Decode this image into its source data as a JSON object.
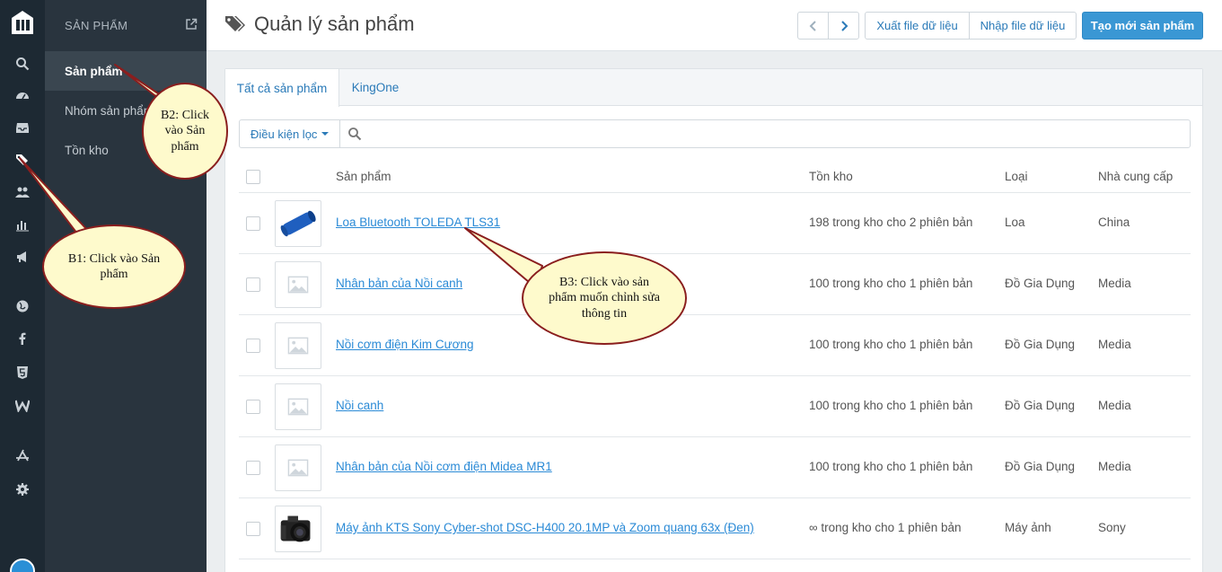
{
  "sidebar": {
    "section_title": "SẢN PHẨM",
    "items": [
      {
        "label": "Sản phẩm"
      },
      {
        "label": "Nhóm sản phẩm"
      },
      {
        "label": "Tồn kho"
      }
    ]
  },
  "header": {
    "title": "Quản lý sản phẩm",
    "export_label": "Xuất file dữ liệu",
    "import_label": "Nhập file dữ liệu",
    "create_label": "Tạo mới sản phẩm"
  },
  "tabs": [
    {
      "label": "Tất cả sản phẩm"
    },
    {
      "label": "KingOne"
    }
  ],
  "filter": {
    "dropdown_label": "Điều kiện lọc",
    "search_placeholder": ""
  },
  "table": {
    "columns": [
      "Sản phẩm",
      "Tồn kho",
      "Loại",
      "Nhà cung cấp"
    ],
    "rows": [
      {
        "name": "Loa Bluetooth TOLEDA TLS31",
        "stock": "198 trong kho cho 2 phiên bản",
        "type": "Loa",
        "vendor": "China",
        "thumb": "speaker"
      },
      {
        "name": "Nhân bản của Nồi canh",
        "stock": "100 trong kho cho 1 phiên bản",
        "type": "Đồ Gia Dụng",
        "vendor": "Media",
        "thumb": "placeholder"
      },
      {
        "name": "Nồi cơm điện Kim Cương",
        "stock": "100 trong kho cho 1 phiên bản",
        "type": "Đồ Gia Dụng",
        "vendor": "Media",
        "thumb": "placeholder"
      },
      {
        "name": "Nồi canh",
        "stock": "100 trong kho cho 1 phiên bản",
        "type": "Đồ Gia Dụng",
        "vendor": "Media",
        "thumb": "placeholder"
      },
      {
        "name": "Nhân bản của Nồi cơm điện Midea MR1",
        "stock": "100 trong kho cho 1 phiên bản",
        "type": "Đồ Gia Dụng",
        "vendor": "Media",
        "thumb": "placeholder"
      },
      {
        "name": "Máy ảnh KTS Sony Cyber-shot DSC-H400 20.1MP và Zoom quang 63x (Đen)",
        "stock": "∞ trong kho cho 1 phiên bản",
        "type": "Máy ảnh",
        "vendor": "Sony",
        "thumb": "camera"
      }
    ]
  },
  "callouts": {
    "b1": "B1: Click vào Sản phẩm",
    "b2": "B2: Click vào Sản phẩm",
    "b3": "B3: Click vào sản phẩm muốn chỉnh sửa thông tin"
  },
  "colors": {
    "rail": "#1d2933",
    "sidebar": "#29343e",
    "accent": "#3a97d4",
    "link": "#2a8ad6",
    "callout_fill": "#fefacc",
    "callout_border": "#8a1e1e"
  }
}
